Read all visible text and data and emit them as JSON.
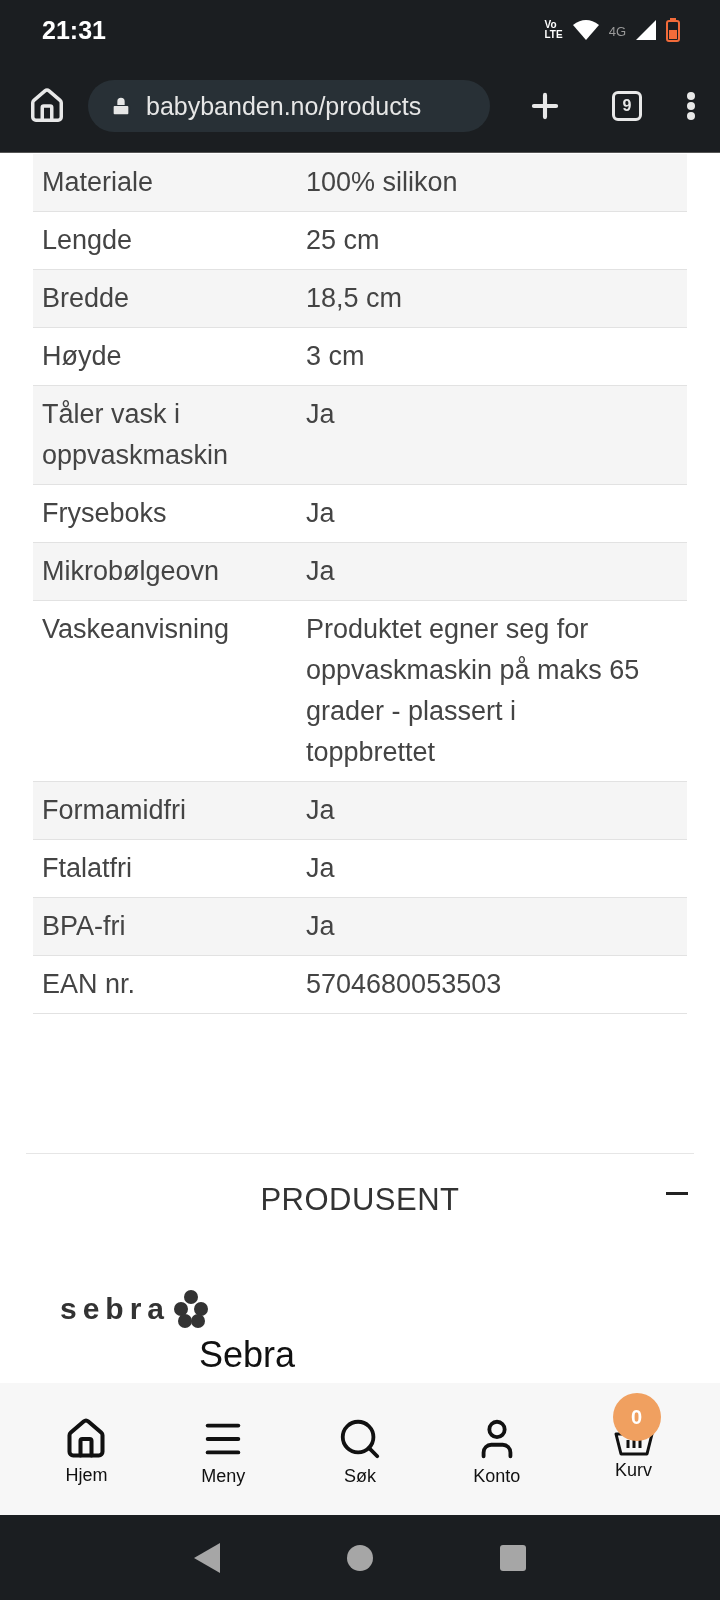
{
  "status_bar": {
    "time": "21:31",
    "volte_top": "Vo",
    "volte_bottom": "LTE",
    "network": "4G"
  },
  "browser": {
    "url": "babybanden.no/products",
    "tab_count": "9"
  },
  "spec_table": {
    "rows": [
      {
        "label": "Materiale",
        "value": "100% silikon"
      },
      {
        "label": "Lengde",
        "value": "25 cm"
      },
      {
        "label": "Bredde",
        "value": "18,5 cm"
      },
      {
        "label": "Høyde",
        "value": "3 cm"
      },
      {
        "label": "Tåler vask i oppvaskmaskin",
        "value": "Ja"
      },
      {
        "label": "Fryseboks",
        "value": "Ja"
      },
      {
        "label": "Mikrobølgeovn",
        "value": "Ja"
      },
      {
        "label": "Vaskeanvisning",
        "value": "Produktet egner seg for oppvaskmaskin på maks 65 grader - plassert i toppbrettet"
      },
      {
        "label": "Formamidfri",
        "value": "Ja"
      },
      {
        "label": "Ftalatfri",
        "value": "Ja"
      },
      {
        "label": "BPA-fri",
        "value": "Ja"
      },
      {
        "label": "EAN nr.",
        "value": "5704680053503"
      }
    ]
  },
  "manufacturer": {
    "heading": "PRODUSENT",
    "expanded": true,
    "logo_text": "sebra",
    "name": "Sebra"
  },
  "bottom_nav": {
    "items": [
      {
        "kind": "home",
        "label": "Hjem"
      },
      {
        "kind": "menu",
        "label": "Meny"
      },
      {
        "kind": "search",
        "label": "Søk"
      },
      {
        "kind": "account",
        "label": "Konto"
      },
      {
        "kind": "cart",
        "label": "Kurv",
        "badge": "0"
      }
    ]
  }
}
